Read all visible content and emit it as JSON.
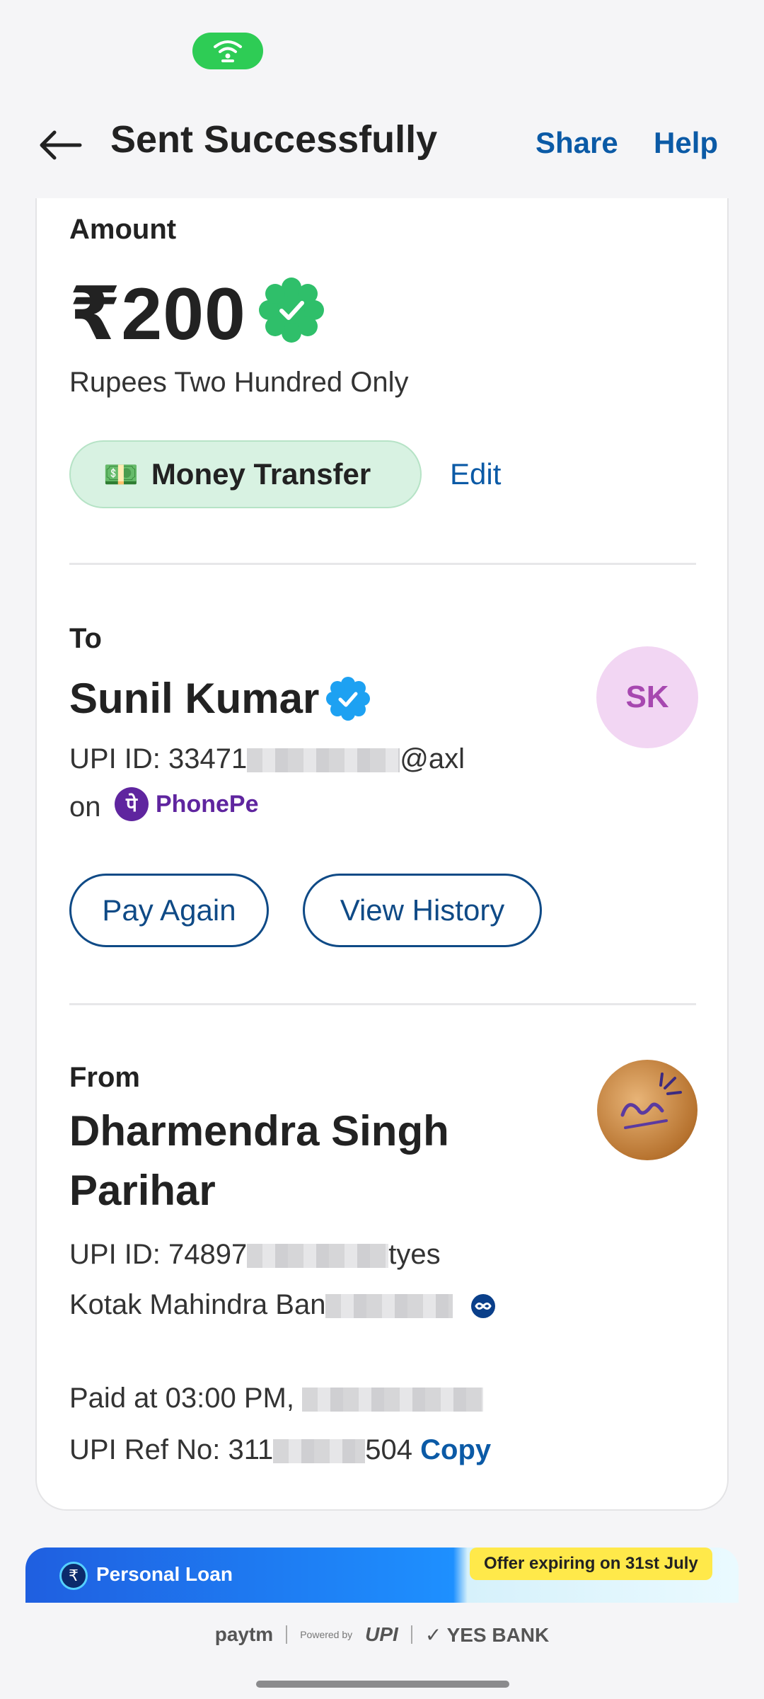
{
  "header": {
    "title": "Sent Successfully",
    "share_label": "Share",
    "help_label": "Help"
  },
  "amount": {
    "label": "Amount",
    "value": "₹200",
    "in_words": "Rupees Two Hundred Only",
    "category_chip": "Money Transfer",
    "edit_label": "Edit"
  },
  "to": {
    "label": "To",
    "name": "Sunil Kumar",
    "initials": "SK",
    "upi_prefix": "UPI ID: 33471",
    "upi_suffix": "@axl",
    "on_label": "on",
    "app_name": "PhonePe",
    "pay_again_label": "Pay Again",
    "view_history_label": "View History"
  },
  "from": {
    "label": "From",
    "name": "Dharmendra Singh Parihar",
    "upi_prefix": "UPI ID: 74897",
    "upi_suffix": "tyes",
    "bank_prefix": "Kotak Mahindra Ban"
  },
  "meta": {
    "paid_at_prefix": "Paid at 03:00 PM,",
    "ref_prefix": "UPI Ref No: 311",
    "ref_suffix": "504",
    "copy_label": "Copy"
  },
  "banner": {
    "loan_label": "Personal Loan",
    "offer_label": "Offer expiring on 31st July"
  },
  "footer": {
    "brand_1": "paytm",
    "powered_by": "Powered by",
    "brand_2": "UPI",
    "brand_3": "YES BANK"
  },
  "colors": {
    "accent_blue": "#0b5aa6",
    "success_green": "#2ecc55",
    "chip_green": "#d8f2e2",
    "avatar_purple": "#f2d6f3"
  }
}
